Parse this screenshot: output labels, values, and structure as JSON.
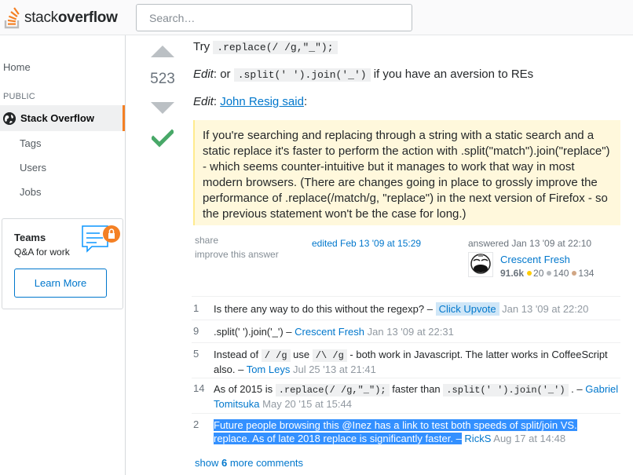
{
  "header": {
    "logo_part1": "stack",
    "logo_part2": "overflow",
    "search_placeholder": "Search…"
  },
  "sidebar": {
    "home": "Home",
    "section_public": "PUBLIC",
    "stack_overflow": "Stack Overflow",
    "tags": "Tags",
    "users": "Users",
    "jobs": "Jobs",
    "teams_title": "Teams",
    "teams_sub": "Q&A for work",
    "learn_more": "Learn More"
  },
  "answer": {
    "votes": "523",
    "line1_prefix": "Try",
    "line1_code": ".replace(/ /g,\"_\");",
    "line2_edit": "Edit",
    "line2_mid": ": or",
    "line2_code": ".split(' ').join('_')",
    "line2_suffix": "if you have an aversion to REs",
    "line3_edit": "Edit",
    "line3_colon": ":",
    "line3_link": "John Resig said",
    "line3_end": ":",
    "quote": "If you're searching and replacing through a string with a static search and a static replace it's faster to perform the action with .split(\"match\").join(\"replace\") - which seems counter-intuitive but it manages to work that way in most modern browsers. (There are changes going in place to grossly improve the performance of .replace(/match/g, \"replace\") in the next version of Firefox - so the previous statement won't be the case for long.)",
    "share": "share",
    "improve": "improve this answer",
    "edited": "edited Feb 13 '09 at 15:29",
    "answered": "answered Jan 13 '09 at 22:10",
    "user_name": "Crescent Fresh",
    "reputation": "91.6k",
    "gold": "20",
    "silver": "140",
    "bronze": "134",
    "colors": {
      "gold": "#ffcc01",
      "silver": "#b4b8bc",
      "bronze": "#d1a684"
    }
  },
  "comments": [
    {
      "score": "1",
      "text": "Is there any way to do this without the regexp? –",
      "user": "Click Upvote",
      "date": "Jan 13 '09 at 22:20"
    },
    {
      "score": "9",
      "text": ".split(' ').join('_') –",
      "user": "Crescent Fresh",
      "date": "Jan 13 '09 at 22:31"
    },
    {
      "score": "5",
      "text_a": "Instead of",
      "code_a": "/ /g",
      "text_b": "use",
      "code_b": "/\\ /g",
      "text_c": "- both work in Javascript. The latter works in CoffeeScript also. –",
      "user": "Tom Leys",
      "date": "Jul 25 '13 at 21:41"
    },
    {
      "score": "14",
      "text_a": "As of 2015 is",
      "code_a": ".replace(/ /g,\"_\");",
      "text_b": "faster than",
      "code_b": ".split(' ').join('_')",
      "text_c": ". –",
      "user": "Gabriel Tomitsuka",
      "date": "May 20 '15 at 15:44"
    },
    {
      "score": "2",
      "line1": "Future people browsing this @Inez has a link to test both speeds of split/join VS.",
      "line2": "replace. As of late 2018 replace is significantly faster.",
      "dash": " –",
      "user": "RickS",
      "date": "Aug 17 at 14:48"
    }
  ],
  "show_more": {
    "prefix": "show",
    "count": "6",
    "suffix": "more comments"
  }
}
